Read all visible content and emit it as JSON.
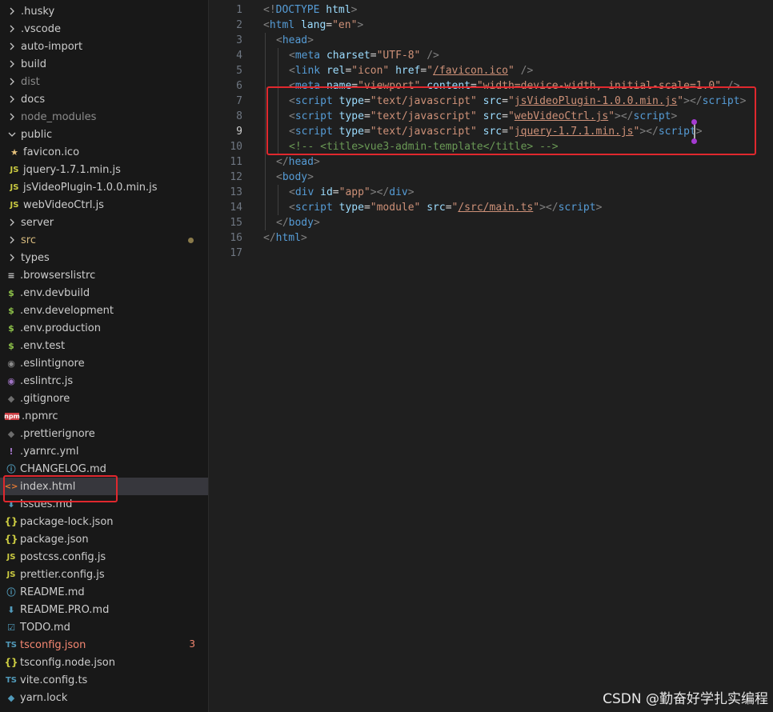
{
  "explorer": {
    "items": [
      {
        "label": ".husky",
        "kind": "folder",
        "icon": "chevron-right-icon"
      },
      {
        "label": ".vscode",
        "kind": "folder",
        "icon": "chevron-right-icon"
      },
      {
        "label": "auto-import",
        "kind": "folder",
        "icon": "chevron-right-icon"
      },
      {
        "label": "build",
        "kind": "folder",
        "icon": "chevron-right-icon"
      },
      {
        "label": "dist",
        "kind": "folder",
        "icon": "chevron-right-icon",
        "dim": true
      },
      {
        "label": "docs",
        "kind": "folder",
        "icon": "chevron-right-icon"
      },
      {
        "label": "node_modules",
        "kind": "folder",
        "icon": "chevron-right-icon",
        "dim": true
      },
      {
        "label": "public",
        "kind": "folder-open",
        "icon": "chevron-down-icon"
      },
      {
        "label": "favicon.ico",
        "kind": "file",
        "icon": "star-icon",
        "glyph": "★",
        "color": "#e5c07b",
        "indent": 1
      },
      {
        "label": "jquery-1.7.1.min.js",
        "kind": "file",
        "icon": "javascript-file-icon",
        "glyph": "JS",
        "color": "#cbcb41",
        "indent": 1
      },
      {
        "label": "jsVideoPlugin-1.0.0.min.js",
        "kind": "file",
        "icon": "javascript-file-icon",
        "glyph": "JS",
        "color": "#cbcb41",
        "indent": 1
      },
      {
        "label": "webVideoCtrl.js",
        "kind": "file",
        "icon": "javascript-file-icon",
        "glyph": "JS",
        "color": "#cbcb41",
        "indent": 1
      },
      {
        "label": "server",
        "kind": "folder",
        "icon": "chevron-right-icon"
      },
      {
        "label": "src",
        "kind": "folder",
        "icon": "chevron-right-icon",
        "modified": true
      },
      {
        "label": "types",
        "kind": "folder",
        "icon": "chevron-right-icon"
      },
      {
        "label": ".browserslistrc",
        "kind": "file",
        "icon": "lines-file-icon",
        "glyph": "≡",
        "color": "#c5c5c5"
      },
      {
        "label": ".env.devbuild",
        "kind": "file",
        "icon": "dollar-env-icon",
        "glyph": "$",
        "color": "#8dc149"
      },
      {
        "label": ".env.development",
        "kind": "file",
        "icon": "dollar-env-icon",
        "glyph": "$",
        "color": "#8dc149"
      },
      {
        "label": ".env.production",
        "kind": "file",
        "icon": "dollar-env-icon",
        "glyph": "$",
        "color": "#8dc149"
      },
      {
        "label": ".env.test",
        "kind": "file",
        "icon": "dollar-env-icon",
        "glyph": "$",
        "color": "#8dc149"
      },
      {
        "label": ".eslintignore",
        "kind": "file",
        "icon": "eslint-icon",
        "glyph": "◉",
        "color": "#8b8b8b"
      },
      {
        "label": ".eslintrc.js",
        "kind": "file",
        "icon": "eslint-icon",
        "glyph": "◉",
        "color": "#a074c4"
      },
      {
        "label": ".gitignore",
        "kind": "file",
        "icon": "git-icon",
        "glyph": "◆",
        "color": "#6d6d6d"
      },
      {
        "label": ".npmrc",
        "kind": "file",
        "icon": "npm-icon",
        "glyph": "npm",
        "color": "#cc3e44"
      },
      {
        "label": ".prettierignore",
        "kind": "file",
        "icon": "prettier-icon",
        "glyph": "◆",
        "color": "#6d6d6d"
      },
      {
        "label": ".yarnrc.yml",
        "kind": "file",
        "icon": "exclamation-yaml-icon",
        "glyph": "!",
        "color": "#a074c4"
      },
      {
        "label": "CHANGELOG.md",
        "kind": "file",
        "icon": "info-icon",
        "glyph": "ⓘ",
        "color": "#519aba"
      },
      {
        "label": "index.html",
        "kind": "file",
        "icon": "html-file-icon",
        "glyph": "<>",
        "color": "#e37933",
        "selected": true
      },
      {
        "label": "Issues.md",
        "kind": "file",
        "icon": "markdown-down-arrow-icon",
        "glyph": "⬇",
        "color": "#519aba"
      },
      {
        "label": "package-lock.json",
        "kind": "file",
        "icon": "json-file-icon",
        "glyph": "{}",
        "color": "#cbcb41"
      },
      {
        "label": "package.json",
        "kind": "file",
        "icon": "json-file-icon",
        "glyph": "{}",
        "color": "#cbcb41"
      },
      {
        "label": "postcss.config.js",
        "kind": "file",
        "icon": "javascript-file-icon",
        "glyph": "JS",
        "color": "#cbcb41"
      },
      {
        "label": "prettier.config.js",
        "kind": "file",
        "icon": "javascript-file-icon",
        "glyph": "JS",
        "color": "#cbcb41"
      },
      {
        "label": "README.md",
        "kind": "file",
        "icon": "info-icon",
        "glyph": "ⓘ",
        "color": "#519aba"
      },
      {
        "label": "README.PRO.md",
        "kind": "file",
        "icon": "markdown-down-arrow-icon",
        "glyph": "⬇",
        "color": "#519aba"
      },
      {
        "label": "TODO.md",
        "kind": "file",
        "icon": "todo-icon",
        "glyph": "☑",
        "color": "#519aba"
      },
      {
        "label": "tsconfig.json",
        "kind": "file",
        "icon": "typescript-config-icon",
        "glyph": "TS",
        "color": "#519aba",
        "error": true,
        "badge": "3"
      },
      {
        "label": "tsconfig.node.json",
        "kind": "file",
        "icon": "json-file-icon",
        "glyph": "{}",
        "color": "#cbcb41"
      },
      {
        "label": "vite.config.ts",
        "kind": "file",
        "icon": "typescript-file-icon",
        "glyph": "TS",
        "color": "#519aba"
      },
      {
        "label": "yarn.lock",
        "kind": "file",
        "icon": "yarn-icon",
        "glyph": "◆",
        "color": "#519aba"
      }
    ]
  },
  "editor": {
    "active_line": 9,
    "lines": [
      {
        "n": "1",
        "indent": 0,
        "tokens": [
          [
            "punc",
            "<!"
          ],
          [
            "tag",
            "DOCTYPE"
          ],
          [
            "txt",
            " "
          ],
          [
            "attr",
            "html"
          ],
          [
            "punc",
            ">"
          ]
        ]
      },
      {
        "n": "2",
        "indent": 0,
        "tokens": [
          [
            "punc",
            "<"
          ],
          [
            "tag",
            "html"
          ],
          [
            "txt",
            " "
          ],
          [
            "attr",
            "lang"
          ],
          [
            "txt",
            "="
          ],
          [
            "str",
            "\"en\""
          ],
          [
            "punc",
            ">"
          ]
        ]
      },
      {
        "n": "3",
        "indent": 1,
        "tokens": [
          [
            "punc",
            "<"
          ],
          [
            "tag",
            "head"
          ],
          [
            "punc",
            ">"
          ]
        ]
      },
      {
        "n": "4",
        "indent": 2,
        "tokens": [
          [
            "punc",
            "<"
          ],
          [
            "tag",
            "meta"
          ],
          [
            "txt",
            " "
          ],
          [
            "attr",
            "charset"
          ],
          [
            "txt",
            "="
          ],
          [
            "str",
            "\"UTF-8\""
          ],
          [
            "txt",
            " "
          ],
          [
            "punc",
            "/>"
          ]
        ]
      },
      {
        "n": "5",
        "indent": 2,
        "tokens": [
          [
            "punc",
            "<"
          ],
          [
            "tag",
            "link"
          ],
          [
            "txt",
            " "
          ],
          [
            "attr",
            "rel"
          ],
          [
            "txt",
            "="
          ],
          [
            "str",
            "\"icon\""
          ],
          [
            "txt",
            " "
          ],
          [
            "attr",
            "href"
          ],
          [
            "txt",
            "="
          ],
          [
            "str",
            "\""
          ],
          [
            "stru",
            "/favicon.ico"
          ],
          [
            "str",
            "\""
          ],
          [
            "txt",
            " "
          ],
          [
            "punc",
            "/>"
          ]
        ]
      },
      {
        "n": "6",
        "indent": 2,
        "tokens": [
          [
            "punc",
            "<"
          ],
          [
            "tag",
            "meta"
          ],
          [
            "txt",
            " "
          ],
          [
            "attr",
            "name"
          ],
          [
            "txt",
            "="
          ],
          [
            "str",
            "\"viewport\""
          ],
          [
            "txt",
            " "
          ],
          [
            "attr",
            "content"
          ],
          [
            "txt",
            "="
          ],
          [
            "str",
            "\"width=device-width, initial-scale=1.0\""
          ],
          [
            "txt",
            " "
          ],
          [
            "punc",
            "/>"
          ]
        ]
      },
      {
        "n": "7",
        "indent": 2,
        "tokens": [
          [
            "punc",
            "<"
          ],
          [
            "tag",
            "script"
          ],
          [
            "txt",
            " "
          ],
          [
            "attr",
            "type"
          ],
          [
            "txt",
            "="
          ],
          [
            "str",
            "\"text/javascript\""
          ],
          [
            "txt",
            " "
          ],
          [
            "attr",
            "src"
          ],
          [
            "txt",
            "="
          ],
          [
            "str",
            "\""
          ],
          [
            "stru",
            "jsVideoPlugin-1.0.0.min.js"
          ],
          [
            "str",
            "\""
          ],
          [
            "punc",
            "></"
          ],
          [
            "tag",
            "script"
          ],
          [
            "punc",
            ">"
          ]
        ]
      },
      {
        "n": "8",
        "indent": 2,
        "tokens": [
          [
            "punc",
            "<"
          ],
          [
            "tag",
            "script"
          ],
          [
            "txt",
            " "
          ],
          [
            "attr",
            "type"
          ],
          [
            "txt",
            "="
          ],
          [
            "str",
            "\"text/javascript\""
          ],
          [
            "txt",
            " "
          ],
          [
            "attr",
            "src"
          ],
          [
            "txt",
            "="
          ],
          [
            "str",
            "\""
          ],
          [
            "stru",
            "webVideoCtrl.js"
          ],
          [
            "str",
            "\""
          ],
          [
            "punc",
            "></"
          ],
          [
            "tag",
            "script"
          ],
          [
            "punc",
            ">"
          ]
        ]
      },
      {
        "n": "9",
        "indent": 2,
        "tokens": [
          [
            "punc",
            "<"
          ],
          [
            "tag",
            "script"
          ],
          [
            "txt",
            " "
          ],
          [
            "attr",
            "type"
          ],
          [
            "txt",
            "="
          ],
          [
            "str",
            "\"text/javascript\""
          ],
          [
            "txt",
            " "
          ],
          [
            "attr",
            "src"
          ],
          [
            "txt",
            "="
          ],
          [
            "str",
            "\""
          ],
          [
            "stru",
            "jquery-1.7.1.min.js"
          ],
          [
            "str",
            "\""
          ],
          [
            "punc",
            "></"
          ],
          [
            "tag",
            "script"
          ],
          [
            "punc",
            ">"
          ]
        ]
      },
      {
        "n": "10",
        "indent": 2,
        "tokens": [
          [
            "cmt",
            "<!-- <title>vue3-admin-template</title> -->"
          ]
        ]
      },
      {
        "n": "11",
        "indent": 1,
        "tokens": [
          [
            "punc",
            "</"
          ],
          [
            "tag",
            "head"
          ],
          [
            "punc",
            ">"
          ]
        ]
      },
      {
        "n": "12",
        "indent": 1,
        "tokens": [
          [
            "punc",
            "<"
          ],
          [
            "tag",
            "body"
          ],
          [
            "punc",
            ">"
          ]
        ]
      },
      {
        "n": "13",
        "indent": 2,
        "tokens": [
          [
            "punc",
            "<"
          ],
          [
            "tag",
            "div"
          ],
          [
            "txt",
            " "
          ],
          [
            "attr",
            "id"
          ],
          [
            "txt",
            "="
          ],
          [
            "str",
            "\"app\""
          ],
          [
            "punc",
            "></"
          ],
          [
            "tag",
            "div"
          ],
          [
            "punc",
            ">"
          ]
        ]
      },
      {
        "n": "14",
        "indent": 2,
        "tokens": [
          [
            "punc",
            "<"
          ],
          [
            "tag",
            "script"
          ],
          [
            "txt",
            " "
          ],
          [
            "attr",
            "type"
          ],
          [
            "txt",
            "="
          ],
          [
            "str",
            "\"module\""
          ],
          [
            "txt",
            " "
          ],
          [
            "attr",
            "src"
          ],
          [
            "txt",
            "="
          ],
          [
            "str",
            "\""
          ],
          [
            "stru",
            "/src/main.ts"
          ],
          [
            "str",
            "\""
          ],
          [
            "punc",
            "></"
          ],
          [
            "tag",
            "script"
          ],
          [
            "punc",
            ">"
          ]
        ]
      },
      {
        "n": "15",
        "indent": 1,
        "tokens": [
          [
            "punc",
            "</"
          ],
          [
            "tag",
            "body"
          ],
          [
            "punc",
            ">"
          ]
        ]
      },
      {
        "n": "16",
        "indent": 0,
        "tokens": [
          [
            "punc",
            "</"
          ],
          [
            "tag",
            "html"
          ],
          [
            "punc",
            ">"
          ]
        ]
      },
      {
        "n": "17",
        "indent": 0,
        "tokens": []
      }
    ]
  },
  "annotations": {
    "highlight_color": "#e0282e"
  },
  "watermark": "CSDN @勤奋好学扎实编程"
}
